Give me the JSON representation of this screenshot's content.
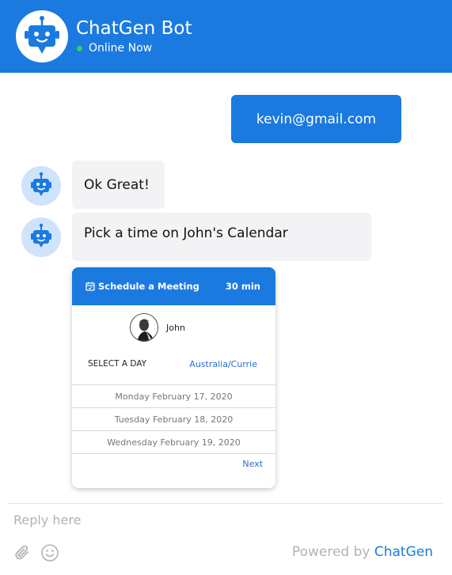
{
  "header": {
    "title": "ChatGen Bot",
    "status": "Online Now",
    "avatar_icon": "robot-icon"
  },
  "messages": {
    "user_email": "kevin@gmail.com",
    "bot_1": "Ok Great!",
    "bot_2": "Pick a time on John's Calendar"
  },
  "meeting": {
    "title": "Schedule a Meeting",
    "duration": "30 min",
    "host": "John",
    "select_day": "SELECT A DAY",
    "timezone": "Australia/Currie",
    "days": [
      "Monday February 17, 2020",
      "Tuesday February 18, 2020",
      "Wednesday February 19, 2020"
    ],
    "next": "Next"
  },
  "composer": {
    "placeholder": "Reply here",
    "attach_icon": "paperclip-icon",
    "emoji_icon": "smiley-icon"
  },
  "footer": {
    "powered_by": "Powered by",
    "brand": "ChatGen"
  },
  "colors": {
    "accent": "#1a7ae0",
    "bubble": "#f3f2f4",
    "bot_avatar_bg": "#cfe3fa",
    "online": "#34d058"
  }
}
